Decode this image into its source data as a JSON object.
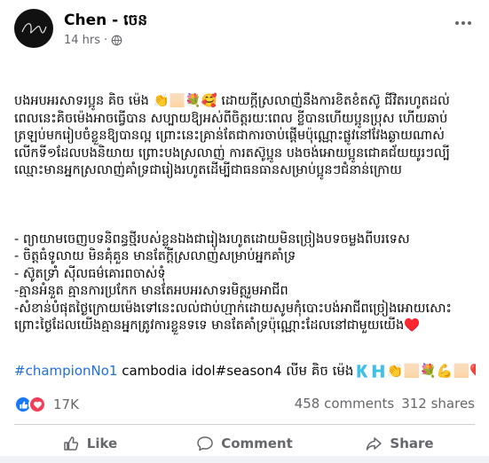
{
  "post": {
    "author": "Chen - ចេន",
    "time": "14 hrs",
    "separator": "·",
    "paragraph1": "បងអបអរសាទរប្អូន គិច ម៉េង 👏🏻💐🥰 ដោយក្ដីស្រលាញ់នឹងការខិតខំតស៊ូ ជីវិតរហូតដល់ពេលនេះគិចម៉េងអាចធ្វើបាន សប្បាយឱ្យអស់ពីចិត្តរយៈពេល ខ្លីបានហើយប្អូនប្រុស ហើយឆាប់ត្រឡប់មករៀបចំខ្លួនឱ្យបានល្អ ព្រោះនេះគ្រាន់តែជាការចាប់ផ្ដើមប៉ុណ្ណោះផ្លូវនៅវែងឆ្ងាយណាស់ លើកទី១ដែលបងនិយាយ ព្រោះបងស្រលាញ់ ការតស៊ូប្អូន បងចង់អោយប្អូនជោគជ័យយូរៗល្បីឈ្មោះមានអ្នកស្រលាញ់គាំទ្រជារៀងរហូតដើម្បីជាធនធានសម្រាប់ប្អូនៗជំនាន់ក្រោយ",
    "paragraph2": "- ព្យាយាមចេញបទនិពន្ធថ្មីរបស់ខ្លួនឯងជារៀងរហូតដោយមិនច្រៀងបទចម្លងពីបរទេស\n- ចិត្តធំទូលាយ មិនគុំគួន មានតែក្ដីស្រលាញ់សម្រាប់អ្នកគាំទ្រ\n- ស៊ូតទ្រាំ ស៊ីលធម៌គោរពចាស់ទុំ\n-គ្មានអំនួត គ្មានការប្រកែក មានតែអបអរសាទរមិត្តរួមអាជីព\n-សំខាន់បំផុតថ្ងៃក្រោយម៉េងទៅនេះលល់ជាប់ហ្មាក់ដោយសូមកុំបោះបង់អាជីពច្រៀងអោយសោះព្រោះថ្ងៃដែលយើងគ្មានអ្នកត្រូវការខ្លួនទទេ មានតែគាំទ្រប៉ុណ្ណោះដែលនៅជាមួយយើង♥️"
  },
  "tags": {
    "hashtag": "#championNo1",
    "rest": " cambodia idol#season4 លីម គិច ម៉េង🇰🇭👏🏻💐💪🏻❤️"
  },
  "stats": {
    "reaction_count": "17K",
    "comments": "458 comments",
    "shares": "312 shares"
  },
  "actions": {
    "like": "Like",
    "comment": "Comment",
    "share": "Share"
  },
  "colors": {
    "hashtag": "#216fdb",
    "like_blue": "#1877f2",
    "love_red": "#f33e58",
    "muted": "#65676b"
  }
}
